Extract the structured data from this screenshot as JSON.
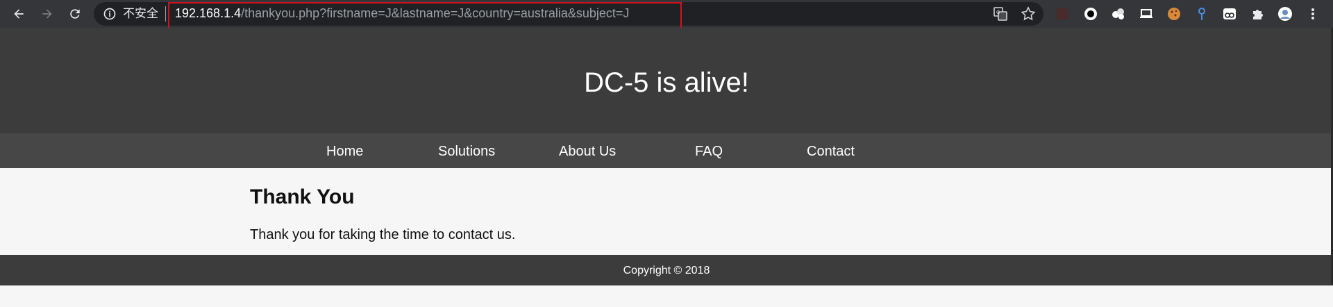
{
  "browser": {
    "security_label": "不安全",
    "url_host": "192.168.1.4",
    "url_path": "/thankyou.php?firstname=J&lastname=J&country=australia&subject=J",
    "icons": [
      "back-icon",
      "forward-icon",
      "reload-icon",
      "info-icon",
      "translate-icon",
      "star-icon",
      "extension-icons",
      "puzzle-icon",
      "profile-avatar",
      "menu-icon"
    ]
  },
  "site": {
    "title": "DC-5 is alive!",
    "nav": [
      "Home",
      "Solutions",
      "About Us",
      "FAQ",
      "Contact"
    ],
    "heading": "Thank You",
    "message": "Thank you for taking the time to contact us.",
    "copyright": "Copyright © 2018"
  },
  "colors": {
    "header_bg": "#3c3c3c",
    "nav_bg": "#474747",
    "content_bg": "#f6f6f6",
    "highlight_box": "#d3131b"
  }
}
